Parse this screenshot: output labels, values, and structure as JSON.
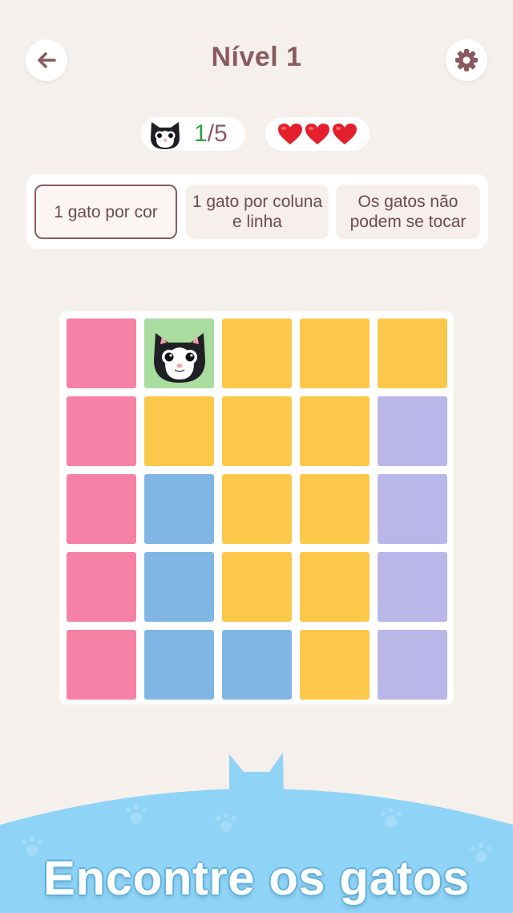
{
  "header": {
    "title": "Nível 1",
    "back_icon": "arrow-left-icon",
    "settings_icon": "gear-icon"
  },
  "stats": {
    "found": "1",
    "total": "/5",
    "lives": 3
  },
  "rules": [
    {
      "label": "1 gato por cor",
      "active": true
    },
    {
      "label": "1 gato por coluna e linha",
      "active": false
    },
    {
      "label": "Os gatos não podem se tocar",
      "active": false
    }
  ],
  "colors": {
    "pink": "#f582a6",
    "yellow": "#fcc84a",
    "blue": "#7fb6e4",
    "purple": "#b9b6e8",
    "found": "#a9dda0",
    "accent": "#8a5a60",
    "banner_blue": "#8fd4f7"
  },
  "grid": [
    [
      "pink",
      "found",
      "yellow",
      "yellow",
      "yellow"
    ],
    [
      "pink",
      "yellow",
      "yellow",
      "yellow",
      "purple"
    ],
    [
      "pink",
      "blue",
      "yellow",
      "yellow",
      "purple"
    ],
    [
      "pink",
      "blue",
      "yellow",
      "yellow",
      "purple"
    ],
    [
      "pink",
      "blue",
      "blue",
      "yellow",
      "purple"
    ]
  ],
  "cats": [
    {
      "row": 0,
      "col": 1
    }
  ],
  "footer": {
    "text": "Encontre os gatos"
  }
}
